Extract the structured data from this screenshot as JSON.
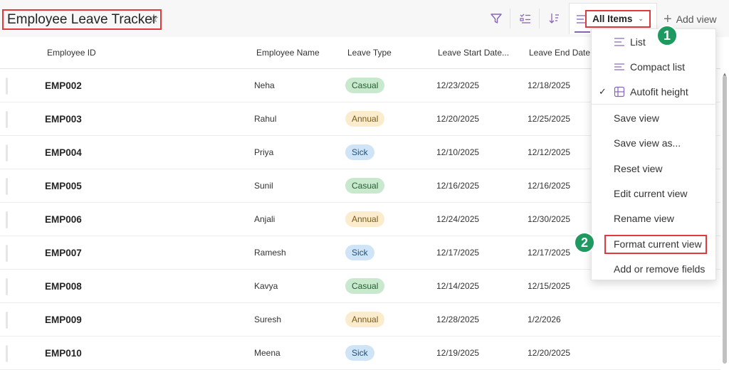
{
  "header": {
    "title": "Employee Leave Tracker",
    "view_name": "All Items",
    "add_view_label": "Add view"
  },
  "columns": [
    "Employee ID",
    "Employee Name",
    "Leave Type",
    "Leave Start Date...",
    "Leave End Date"
  ],
  "rows": [
    {
      "id": "EMP002",
      "name": "Neha",
      "type": "Casual",
      "start": "12/23/2025",
      "end": "12/18/2025"
    },
    {
      "id": "EMP003",
      "name": "Rahul",
      "type": "Annual",
      "start": "12/20/2025",
      "end": "12/25/2025"
    },
    {
      "id": "EMP004",
      "name": "Priya",
      "type": "Sick",
      "start": "12/10/2025",
      "end": "12/12/2025"
    },
    {
      "id": "EMP005",
      "name": "Sunil",
      "type": "Casual",
      "start": "12/16/2025",
      "end": "12/16/2025"
    },
    {
      "id": "EMP006",
      "name": "Anjali",
      "type": "Annual",
      "start": "12/24/2025",
      "end": "12/30/2025"
    },
    {
      "id": "EMP007",
      "name": "Ramesh",
      "type": "Sick",
      "start": "12/17/2025",
      "end": "12/17/2025"
    },
    {
      "id": "EMP008",
      "name": "Kavya",
      "type": "Casual",
      "start": "12/14/2025",
      "end": "12/15/2025"
    },
    {
      "id": "EMP009",
      "name": "Suresh",
      "type": "Annual",
      "start": "12/28/2025",
      "end": "1/2/2026"
    },
    {
      "id": "EMP010",
      "name": "Meena",
      "type": "Sick",
      "start": "12/19/2025",
      "end": "12/20/2025"
    }
  ],
  "view_menu": {
    "items": [
      {
        "label": "List",
        "icon": "list-icon"
      },
      {
        "label": "Compact list",
        "icon": "compact-list-icon"
      },
      {
        "label": "Autofit height",
        "icon": "autofit-icon",
        "checked": true
      },
      {
        "label": "Save view"
      },
      {
        "label": "Save view as..."
      },
      {
        "label": "Reset view"
      },
      {
        "label": "Edit current view"
      },
      {
        "label": "Rename view"
      },
      {
        "label": "Format current view"
      },
      {
        "label": "Add or remove fields"
      }
    ]
  },
  "callouts": [
    "1",
    "2"
  ],
  "colors": {
    "accent": "#8764b8",
    "highlight_box": "#e0393e",
    "callout_badge": "#1e9a60",
    "casual_pill": "#c9e9cf",
    "annual_pill": "#fbeccd",
    "sick_pill": "#cfe5f7"
  }
}
